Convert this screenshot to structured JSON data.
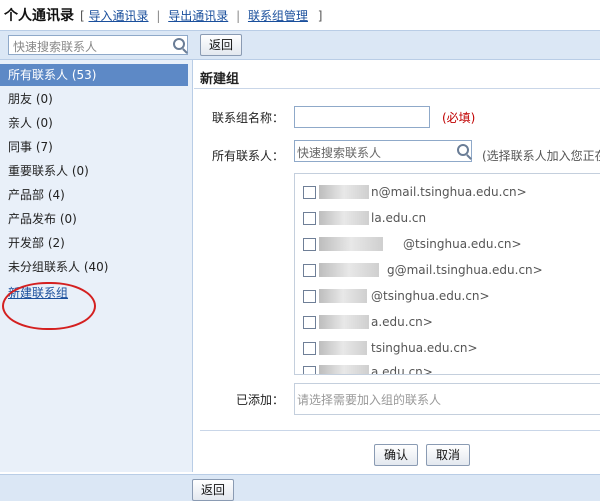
{
  "header": {
    "title": "个人通讯录",
    "bracket_open": "[",
    "bracket_close": "]",
    "links": [
      "导入通讯录",
      "导出通讯录",
      "联系组管理"
    ],
    "separator": "|"
  },
  "search": {
    "placeholder": "快速搜索联系人",
    "icon": "search-icon"
  },
  "toolbar": {
    "back_label": "返回"
  },
  "sidebar": {
    "items": [
      {
        "label": "所有联系人 (53)",
        "active": true
      },
      {
        "label": "朋友 (0)"
      },
      {
        "label": "亲人 (0)"
      },
      {
        "label": "同事 (7)"
      },
      {
        "label": "重要联系人 (0)"
      },
      {
        "label": "产品部 (4)"
      },
      {
        "label": "产品发布 (0)"
      },
      {
        "label": "开发部 (2)"
      },
      {
        "label": "未分组联系人 (40)"
      },
      {
        "label": "新建联系组",
        "link": true
      }
    ],
    "annotation_color": "#d42020"
  },
  "main": {
    "heading": "新建组",
    "group_name_label": "联系组名称：",
    "group_name_value": "",
    "required_note": "(必填)",
    "all_contacts_label": "所有联系人：",
    "contact_search_placeholder": "快速搜索联系人",
    "contact_hint": "(选择联系人加入您正在",
    "contacts": [
      "n@mail.tsinghua.edu.cn>",
      "la.edu.cn",
      "@tsinghua.edu.cn>",
      "g@mail.tsinghua.edu.cn>",
      "@tsinghua.edu.cn>",
      "a.edu.cn>",
      "tsinghua.edu.cn>",
      "a.edu.cn>"
    ],
    "added_label": "已添加：",
    "added_placeholder": "请选择需要加入组的联系人",
    "confirm_label": "确认",
    "cancel_label": "取消"
  },
  "footer": {
    "back_label": "返回"
  },
  "colors": {
    "link": "#1a4f9c",
    "required": "#c00000",
    "active": "#5d89c6",
    "bar": "#dbe7f5"
  }
}
